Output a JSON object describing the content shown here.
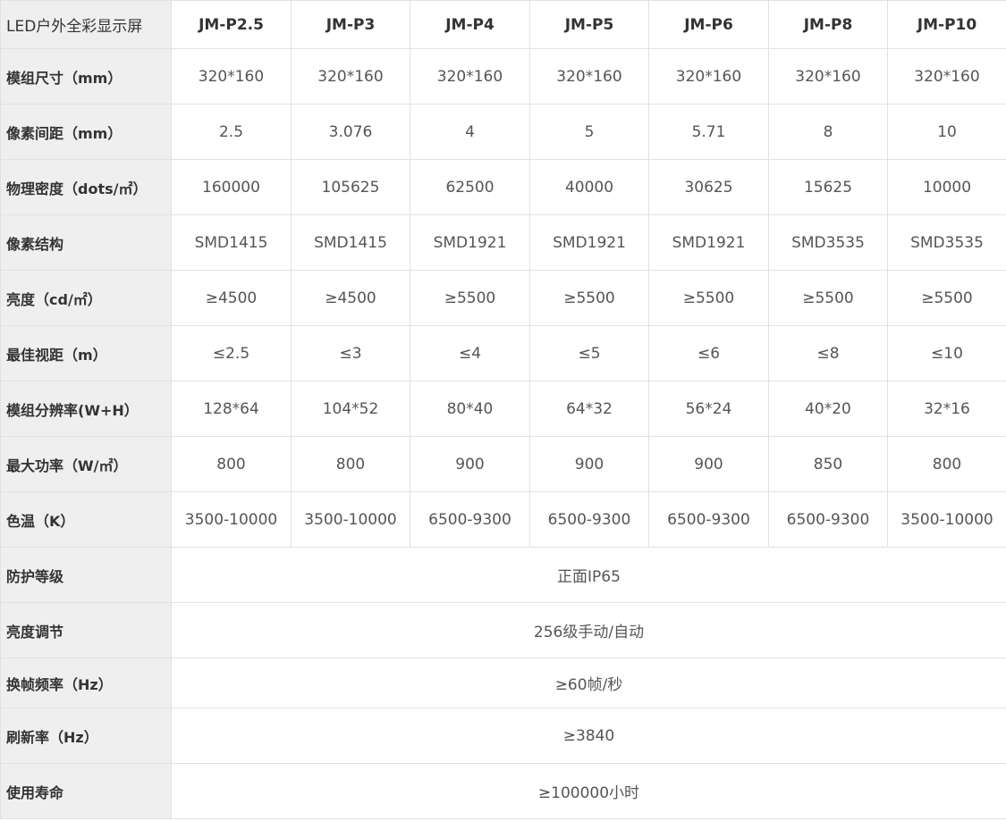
{
  "table": {
    "corner": "LED户外全彩显示屏",
    "models": [
      "JM-P2.5",
      "JM-P3",
      "JM-P4",
      "JM-P5",
      "JM-P6",
      "JM-P8",
      "JM-P10"
    ],
    "rows": [
      {
        "label": "模组尺寸（mm）",
        "values": [
          "320*160",
          "320*160",
          "320*160",
          "320*160",
          "320*160",
          "320*160",
          "320*160"
        ]
      },
      {
        "label": "像素间距（mm）",
        "values": [
          "2.5",
          "3.076",
          "4",
          "5",
          "5.71",
          "8",
          "10"
        ]
      },
      {
        "label": "物理密度（dots/㎡）",
        "values": [
          "160000",
          "105625",
          "62500",
          "40000",
          "30625",
          "15625",
          "10000"
        ]
      },
      {
        "label": "像素结构",
        "values": [
          "SMD1415",
          "SMD1415",
          "SMD1921",
          "SMD1921",
          "SMD1921",
          "SMD3535",
          "SMD3535"
        ]
      },
      {
        "label": "亮度（cd/㎡）",
        "values": [
          "≥4500",
          "≥4500",
          "≥5500",
          "≥5500",
          "≥5500",
          "≥5500",
          "≥5500"
        ]
      },
      {
        "label": "最佳视距（m）",
        "values": [
          "≤2.5",
          "≤3",
          "≤4",
          "≤5",
          "≤6",
          "≤8",
          "≤10"
        ]
      },
      {
        "label": "模组分辨率(W+H）",
        "values": [
          "128*64",
          "104*52",
          "80*40",
          "64*32",
          "56*24",
          "40*20",
          "32*16"
        ]
      },
      {
        "label": "最大功率（W/㎡）",
        "values": [
          "800",
          "800",
          "900",
          "900",
          "900",
          "850",
          "800"
        ]
      },
      {
        "label": "色温（K）",
        "values": [
          "3500-10000",
          "3500-10000",
          "6500-9300",
          "6500-9300",
          "6500-9300",
          "6500-9300",
          "3500-10000"
        ]
      }
    ],
    "merged_rows": [
      {
        "label": "防护等级",
        "value": "正面IP65"
      },
      {
        "label": "亮度调节",
        "value": "256级手动/自动"
      },
      {
        "label": "换帧频率（Hz）",
        "value": "≥60帧/秒"
      },
      {
        "label": "刷新率（Hz）",
        "value": "≥3840"
      },
      {
        "label": "使用寿命",
        "value": "≥100000小时"
      }
    ]
  }
}
